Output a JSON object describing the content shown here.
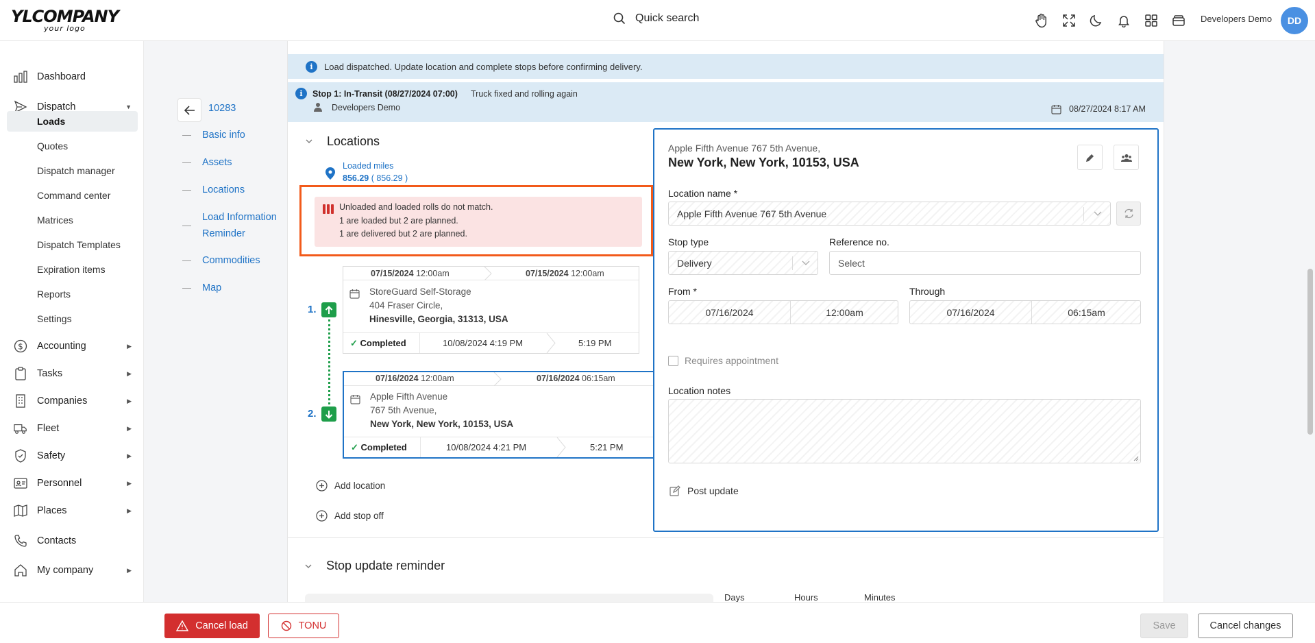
{
  "app": {
    "logo_main": "YLCOMPANY",
    "logo_sub": "your logo",
    "search_placeholder": "Quick search",
    "user_name": "Developers Demo",
    "user_initials": "DD",
    "top_icons": [
      "hand-icon",
      "fullscreen-icon",
      "moon-icon",
      "bell-icon",
      "apps-grid-icon",
      "wallet-icon"
    ]
  },
  "sidebar": {
    "items": [
      {
        "label": "Dashboard",
        "icon": "chart-bar-icon"
      },
      {
        "label": "Dispatch",
        "icon": "send-icon"
      },
      {
        "label": "Accounting",
        "icon": "dollar-icon"
      },
      {
        "label": "Tasks",
        "icon": "clipboard-icon"
      },
      {
        "label": "Companies",
        "icon": "building-icon"
      },
      {
        "label": "Fleet",
        "icon": "truck-icon"
      },
      {
        "label": "Safety",
        "icon": "shield-icon"
      },
      {
        "label": "Personnel",
        "icon": "id-card-icon"
      },
      {
        "label": "Places",
        "icon": "map-icon"
      },
      {
        "label": "Contacts",
        "icon": "phone-icon"
      },
      {
        "label": "My company",
        "icon": "home-icon"
      }
    ],
    "dispatch_sub": [
      "Loads",
      "Quotes",
      "Dispatch manager",
      "Command center",
      "Matrices",
      "Dispatch Templates",
      "Expiration items",
      "Reports",
      "Settings"
    ]
  },
  "subnav": {
    "load_number": "10283",
    "links": [
      "Basic info",
      "Assets",
      "Locations",
      "Load Information Reminder",
      "Commodities",
      "Map"
    ]
  },
  "banners": {
    "dispatched": "Load dispatched. Update location and complete stops before confirming delivery.",
    "stop_status": "Stop 1: In-Transit (08/27/2024 07:00)",
    "stop_note": "Truck fixed and rolling again",
    "stop_user": "Developers Demo",
    "stop_time": "08/27/2024 8:17 AM"
  },
  "locations": {
    "title": "Locations",
    "loaded_miles_label": "Loaded miles",
    "loaded_miles_value": "856.29",
    "loaded_miles_planned": "( 856.29 )",
    "alert_lines": [
      "Unloaded and loaded rolls do not match.",
      "1 are loaded but 2 are planned.",
      "1 are delivered but 2 are planned."
    ],
    "stops": [
      {
        "num": "1.",
        "start_date": "07/15/2024",
        "start_time": "12:00am",
        "end_date": "07/15/2024",
        "end_time": "12:00am",
        "name": "StoreGuard Self-Storage",
        "street": "404 Fraser Circle,",
        "city": "Hinesville, Georgia, 31313, USA",
        "status": "Completed",
        "completed_at": "10/08/2024 4:19 PM",
        "completed_end": "5:19 PM"
      },
      {
        "num": "2.",
        "start_date": "07/16/2024",
        "start_time": "12:00am",
        "end_date": "07/16/2024",
        "end_time": "06:15am",
        "name": "Apple Fifth Avenue",
        "street": "767 5th Avenue,",
        "city": "New York, New York, 10153, USA",
        "status": "Completed",
        "completed_at": "10/08/2024 4:21 PM",
        "completed_end": "5:21 PM"
      }
    ],
    "add_location": "Add location",
    "add_stop_off": "Add stop off"
  },
  "detail": {
    "address_line1": "Apple Fifth Avenue 767 5th Avenue,",
    "address_line2": "New York, New York, 10153, USA",
    "location_name_label": "Location name *",
    "location_name_value": "Apple Fifth Avenue 767 5th Avenue",
    "stop_type_label": "Stop type",
    "stop_type_value": "Delivery",
    "reference_label": "Reference no.",
    "reference_placeholder": "Select",
    "from_label": "From *",
    "from_date": "07/16/2024",
    "from_time": "12:00am",
    "through_label": "Through",
    "through_date": "07/16/2024",
    "through_time": "06:15am",
    "requires_appointment": "Requires appointment",
    "location_notes_label": "Location notes",
    "post_update": "Post update"
  },
  "reminder": {
    "title": "Stop update reminder",
    "days": "Days",
    "hours": "Hours",
    "minutes": "Minutes"
  },
  "footer": {
    "cancel_load": "Cancel load",
    "tonu": "TONU",
    "save": "Save",
    "cancel_changes": "Cancel changes"
  }
}
